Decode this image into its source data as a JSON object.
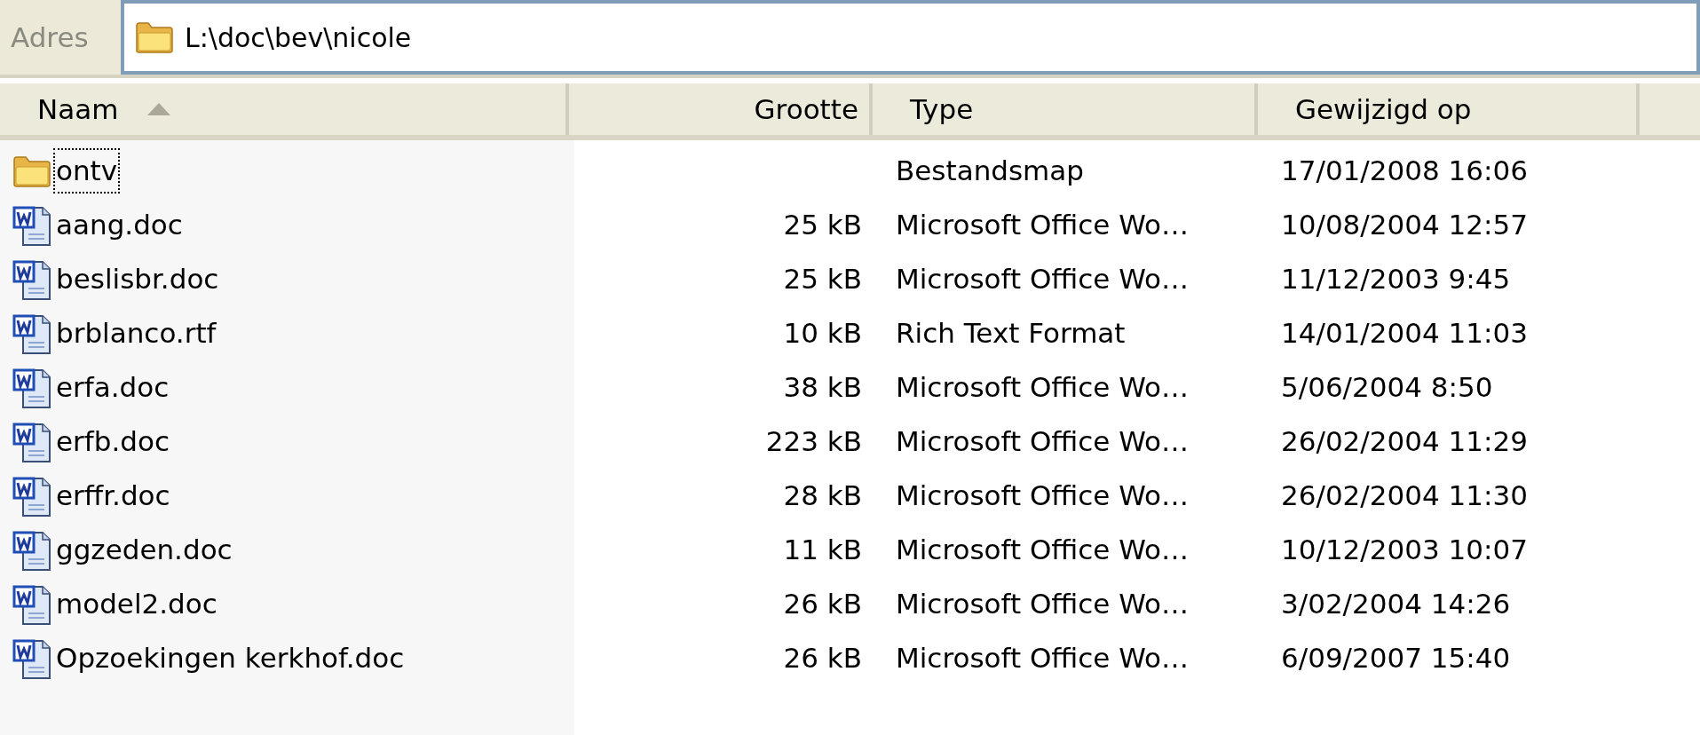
{
  "address_bar": {
    "label": "Adres",
    "value": "L:\\doc\\bev\\nicole"
  },
  "columns": [
    {
      "label": "Naam",
      "sorted": true
    },
    {
      "label": "Grootte",
      "sorted": false
    },
    {
      "label": "Type",
      "sorted": false
    },
    {
      "label": "Gewijzigd op",
      "sorted": false
    }
  ],
  "files": [
    {
      "kind": "folder",
      "name": "ontv",
      "type": "Bestandsmap",
      "modified": "17/01/2008 16:06",
      "focused": true
    },
    {
      "kind": "word",
      "name": "aang.doc",
      "size": "25 kB",
      "type": "Microsoft Office Wo…",
      "modified": "10/08/2004 12:57",
      "focused": false
    },
    {
      "kind": "word",
      "name": "beslisbr.doc",
      "size": "25 kB",
      "type": "Microsoft Office Wo…",
      "modified": "11/12/2003 9:45",
      "focused": false
    },
    {
      "kind": "word",
      "name": "brblanco.rtf",
      "size": "10 kB",
      "type": "Rich Text Format",
      "modified": "14/01/2004 11:03",
      "focused": false
    },
    {
      "kind": "word",
      "name": "erfa.doc",
      "size": "38 kB",
      "type": "Microsoft Office Wo…",
      "modified": "5/06/2004 8:50",
      "focused": false
    },
    {
      "kind": "word",
      "name": "erfb.doc",
      "size": "223 kB",
      "type": "Microsoft Office Wo…",
      "modified": "26/02/2004 11:29",
      "focused": false
    },
    {
      "kind": "word",
      "name": "erffr.doc",
      "size": "28 kB",
      "type": "Microsoft Office Wo…",
      "modified": "26/02/2004 11:30",
      "focused": false
    },
    {
      "kind": "word",
      "name": "ggzeden.doc",
      "size": "11 kB",
      "type": "Microsoft Office Wo…",
      "modified": "10/12/2003 10:07",
      "focused": false
    },
    {
      "kind": "word",
      "name": "model2.doc",
      "size": "26 kB",
      "type": "Microsoft Office Wo…",
      "modified": "3/02/2004 14:26",
      "focused": false
    },
    {
      "kind": "word",
      "name": "Opzoekingen kerkhof.doc",
      "size": "26 kB",
      "type": "Microsoft Office Wo…",
      "modified": "6/09/2007 15:40",
      "focused": false
    }
  ]
}
